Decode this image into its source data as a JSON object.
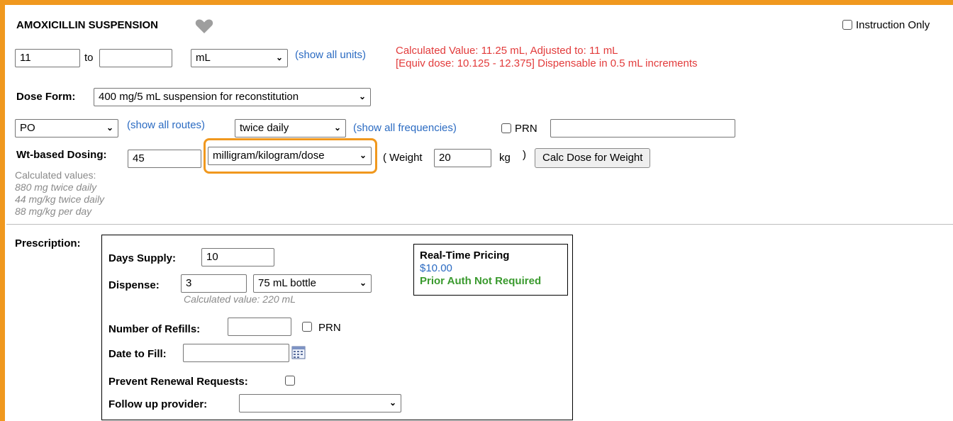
{
  "drug_title": "AMOXICILLIN SUSPENSION",
  "instruction_only_label": "Instruction Only",
  "dose": {
    "from_value": "11",
    "to_label": "to",
    "to_value": "",
    "unit": "mL",
    "show_all_units": "(show all units)",
    "calc_line1": "Calculated Value: 11.25 mL, Adjusted to: 11 mL",
    "calc_line2": "[Equiv dose: 10.125 - 12.375] Dispensable in 0.5 mL increments"
  },
  "dose_form": {
    "label": "Dose Form:",
    "value": "400 mg/5 mL suspension for reconstitution"
  },
  "route": {
    "value": "PO",
    "show_all_routes": "(show all routes)",
    "frequency": "twice daily",
    "show_all_frequencies": "(show all frequencies)",
    "prn_label": "PRN",
    "prn_text": ""
  },
  "wt_dosing": {
    "label": "Wt-based Dosing:",
    "value": "45",
    "unit": "milligram/kilogram/dose",
    "weight_open": "( Weight",
    "weight_value": "20",
    "weight_unit": "kg",
    "weight_close": ")",
    "calc_button": "Calc Dose for Weight",
    "calculated_label": "Calculated values:",
    "calc1": "880 mg twice daily",
    "calc2": "44 mg/kg twice daily",
    "calc3": "88 mg/kg per day"
  },
  "prescription": {
    "label": "Prescription:",
    "days_supply_label": "Days Supply:",
    "days_supply": "10",
    "dispense_label": "Dispense:",
    "dispense_qty": "3",
    "dispense_unit": "75 mL bottle",
    "dispense_calc": "Calculated value: 220 mL",
    "refills_label": "Number of Refills:",
    "refills_value": "",
    "refills_prn": "PRN",
    "date_label": "Date to Fill:",
    "date_value": "",
    "prevent_label": "Prevent Renewal Requests:",
    "followup_label": "Follow up provider:",
    "followup_value": ""
  },
  "pricing": {
    "title": "Real-Time Pricing",
    "price": "$10.00",
    "prior_auth": "Prior Auth Not Required"
  },
  "colors": {
    "accent_border": "#f0981e",
    "link": "#2b6bc2",
    "warning": "#e23b3b",
    "success": "#3a9a2e"
  }
}
